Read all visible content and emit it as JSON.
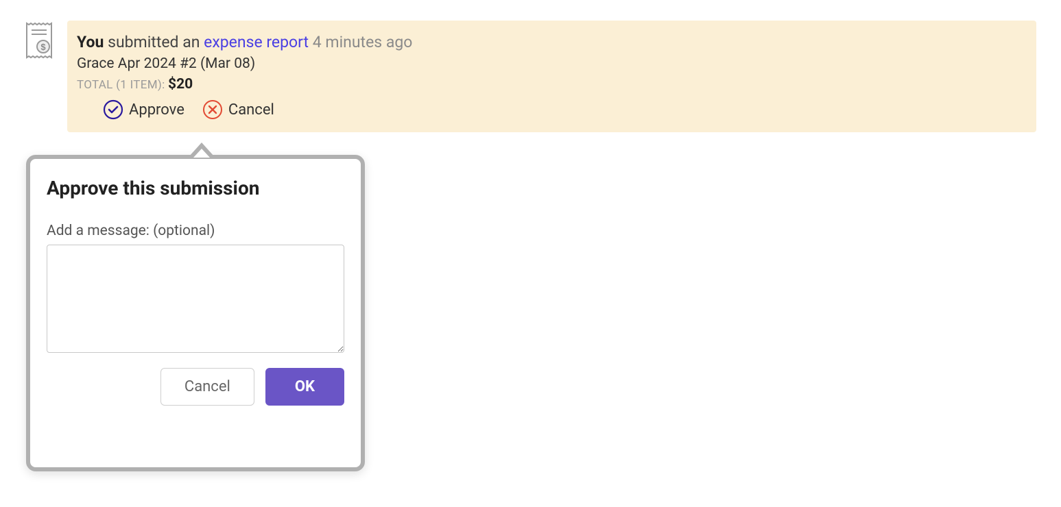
{
  "card": {
    "you_label": "You",
    "submitted_text": " submitted an ",
    "link_text": "expense report",
    "time_text": "4 minutes ago",
    "report_name": "Grace Apr 2024 #2 (Mar 08)",
    "total_label": "TOTAL (1 ITEM): ",
    "total_value": "$20",
    "approve_label": "Approve",
    "cancel_label": "Cancel"
  },
  "popover": {
    "title": "Approve this submission",
    "message_label": "Add a message: (optional)",
    "message_value": "",
    "cancel_label": "Cancel",
    "ok_label": "OK"
  },
  "icons": {
    "receipt": "receipt-icon",
    "check": "check-circle-icon",
    "x": "x-circle-icon"
  }
}
